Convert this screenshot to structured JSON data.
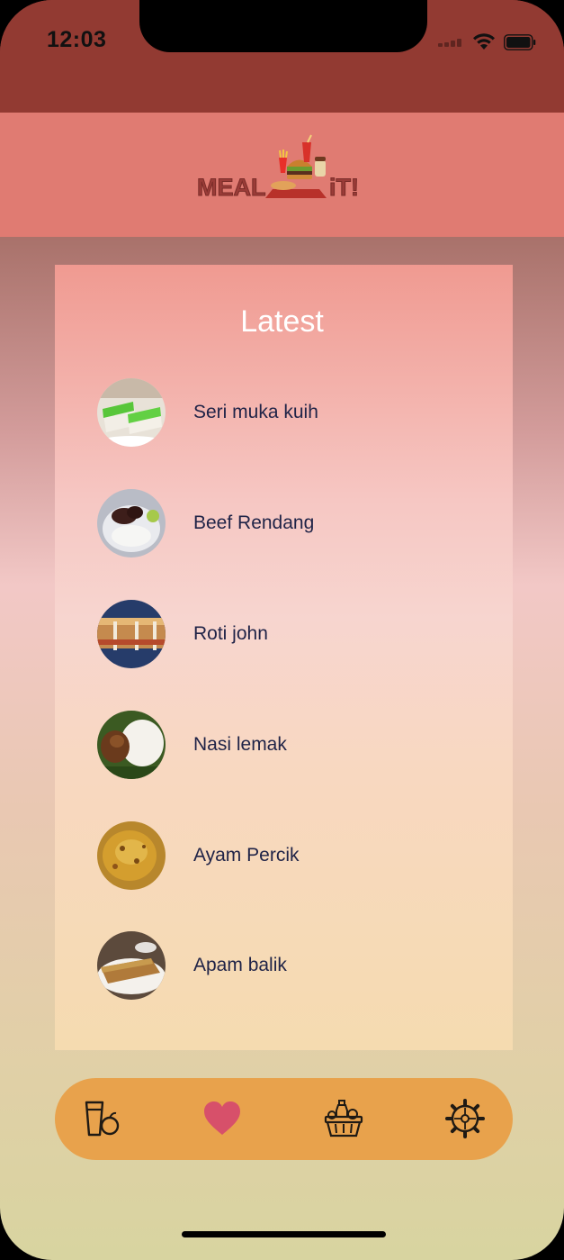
{
  "status_bar": {
    "time": "12:03",
    "wifi_icon": "wifi-icon",
    "battery_icon": "battery-icon",
    "signal_icon": "signal-icon"
  },
  "header": {
    "logo_text_left": "MEAL",
    "logo_text_right": "iT!",
    "background_color": "#e07b72"
  },
  "latest": {
    "title": "Latest",
    "items": [
      {
        "label": "Seri muka kuih",
        "thumbnail": "seri-muka-photo"
      },
      {
        "label": "Beef Rendang",
        "thumbnail": "beef-rendang-photo"
      },
      {
        "label": "Roti john",
        "thumbnail": "roti-john-photo"
      },
      {
        "label": "Nasi lemak",
        "thumbnail": "nasi-lemak-photo"
      },
      {
        "label": "Ayam Percik",
        "thumbnail": "ayam-percik-photo"
      },
      {
        "label": "Apam balik",
        "thumbnail": "apam-balik-photo"
      }
    ]
  },
  "tab_bar": {
    "background_color": "#e8a24c",
    "tabs": [
      {
        "icon": "drink-fruit-icon"
      },
      {
        "icon": "heart-icon",
        "active": true
      },
      {
        "icon": "basket-icon"
      },
      {
        "icon": "settings-gear-icon"
      }
    ]
  }
}
